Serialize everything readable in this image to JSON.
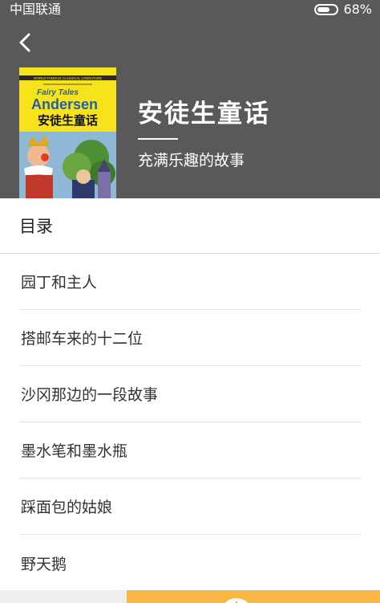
{
  "status_bar": {
    "carrier": "中国联通",
    "battery_percent": "68%",
    "battery_level": 0.68
  },
  "header": {
    "back_icon": "chevron-left-icon",
    "book_title": "安徒生童话",
    "book_subtitle": "充满乐趣的故事",
    "cover": {
      "series_line": "WORLD FAMOUS CLASSICAL LITERATURE",
      "english_line1": "Fairy Tales",
      "english_line2": "Andersen",
      "chinese_title": "安徒生童话"
    }
  },
  "toc": {
    "heading": "目录",
    "items": [
      "园丁和主人",
      "搭邮车来的十二位",
      "沙冈那边的一段故事",
      "墨水笔和墨水瓶",
      "踩面包的姑娘",
      "野天鹅"
    ]
  },
  "colors": {
    "header_bg": "#595959",
    "accent": "#f8b744",
    "cover_yellow": "#f6e31b"
  }
}
